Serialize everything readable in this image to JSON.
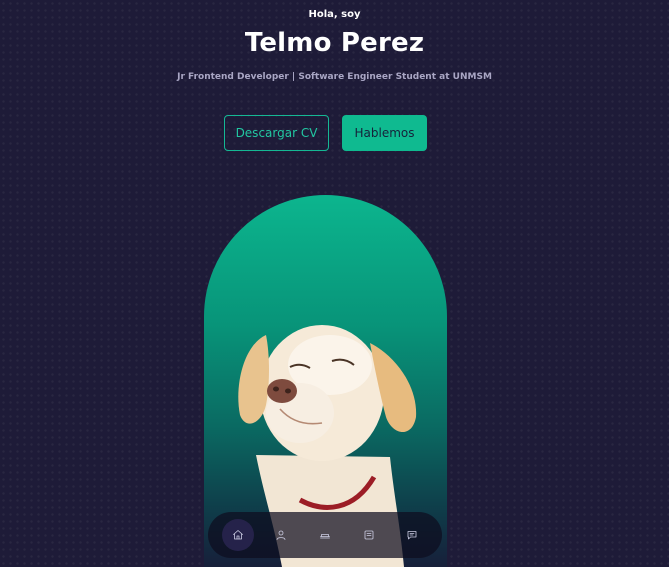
{
  "header": {
    "greeting": "Hola, soy",
    "name": "Telmo Perez",
    "subtitle": "Jr Frontend Developer | Software Engineer Student at UNMSM"
  },
  "cta": {
    "download_label": "Descargar CV",
    "talk_label": "Hablemos"
  },
  "hero": {
    "image_icon": "labrador-dog-photo"
  },
  "nav": {
    "items": [
      {
        "icon": "home-icon",
        "active": true
      },
      {
        "icon": "user-icon",
        "active": false
      },
      {
        "icon": "book-icon",
        "active": false
      },
      {
        "icon": "services-icon",
        "active": false
      },
      {
        "icon": "message-icon",
        "active": false
      }
    ]
  },
  "colors": {
    "background": "#1e1b38",
    "accent": "#0fba90",
    "text": "#ffffff",
    "muted": "#a9a6c4"
  }
}
